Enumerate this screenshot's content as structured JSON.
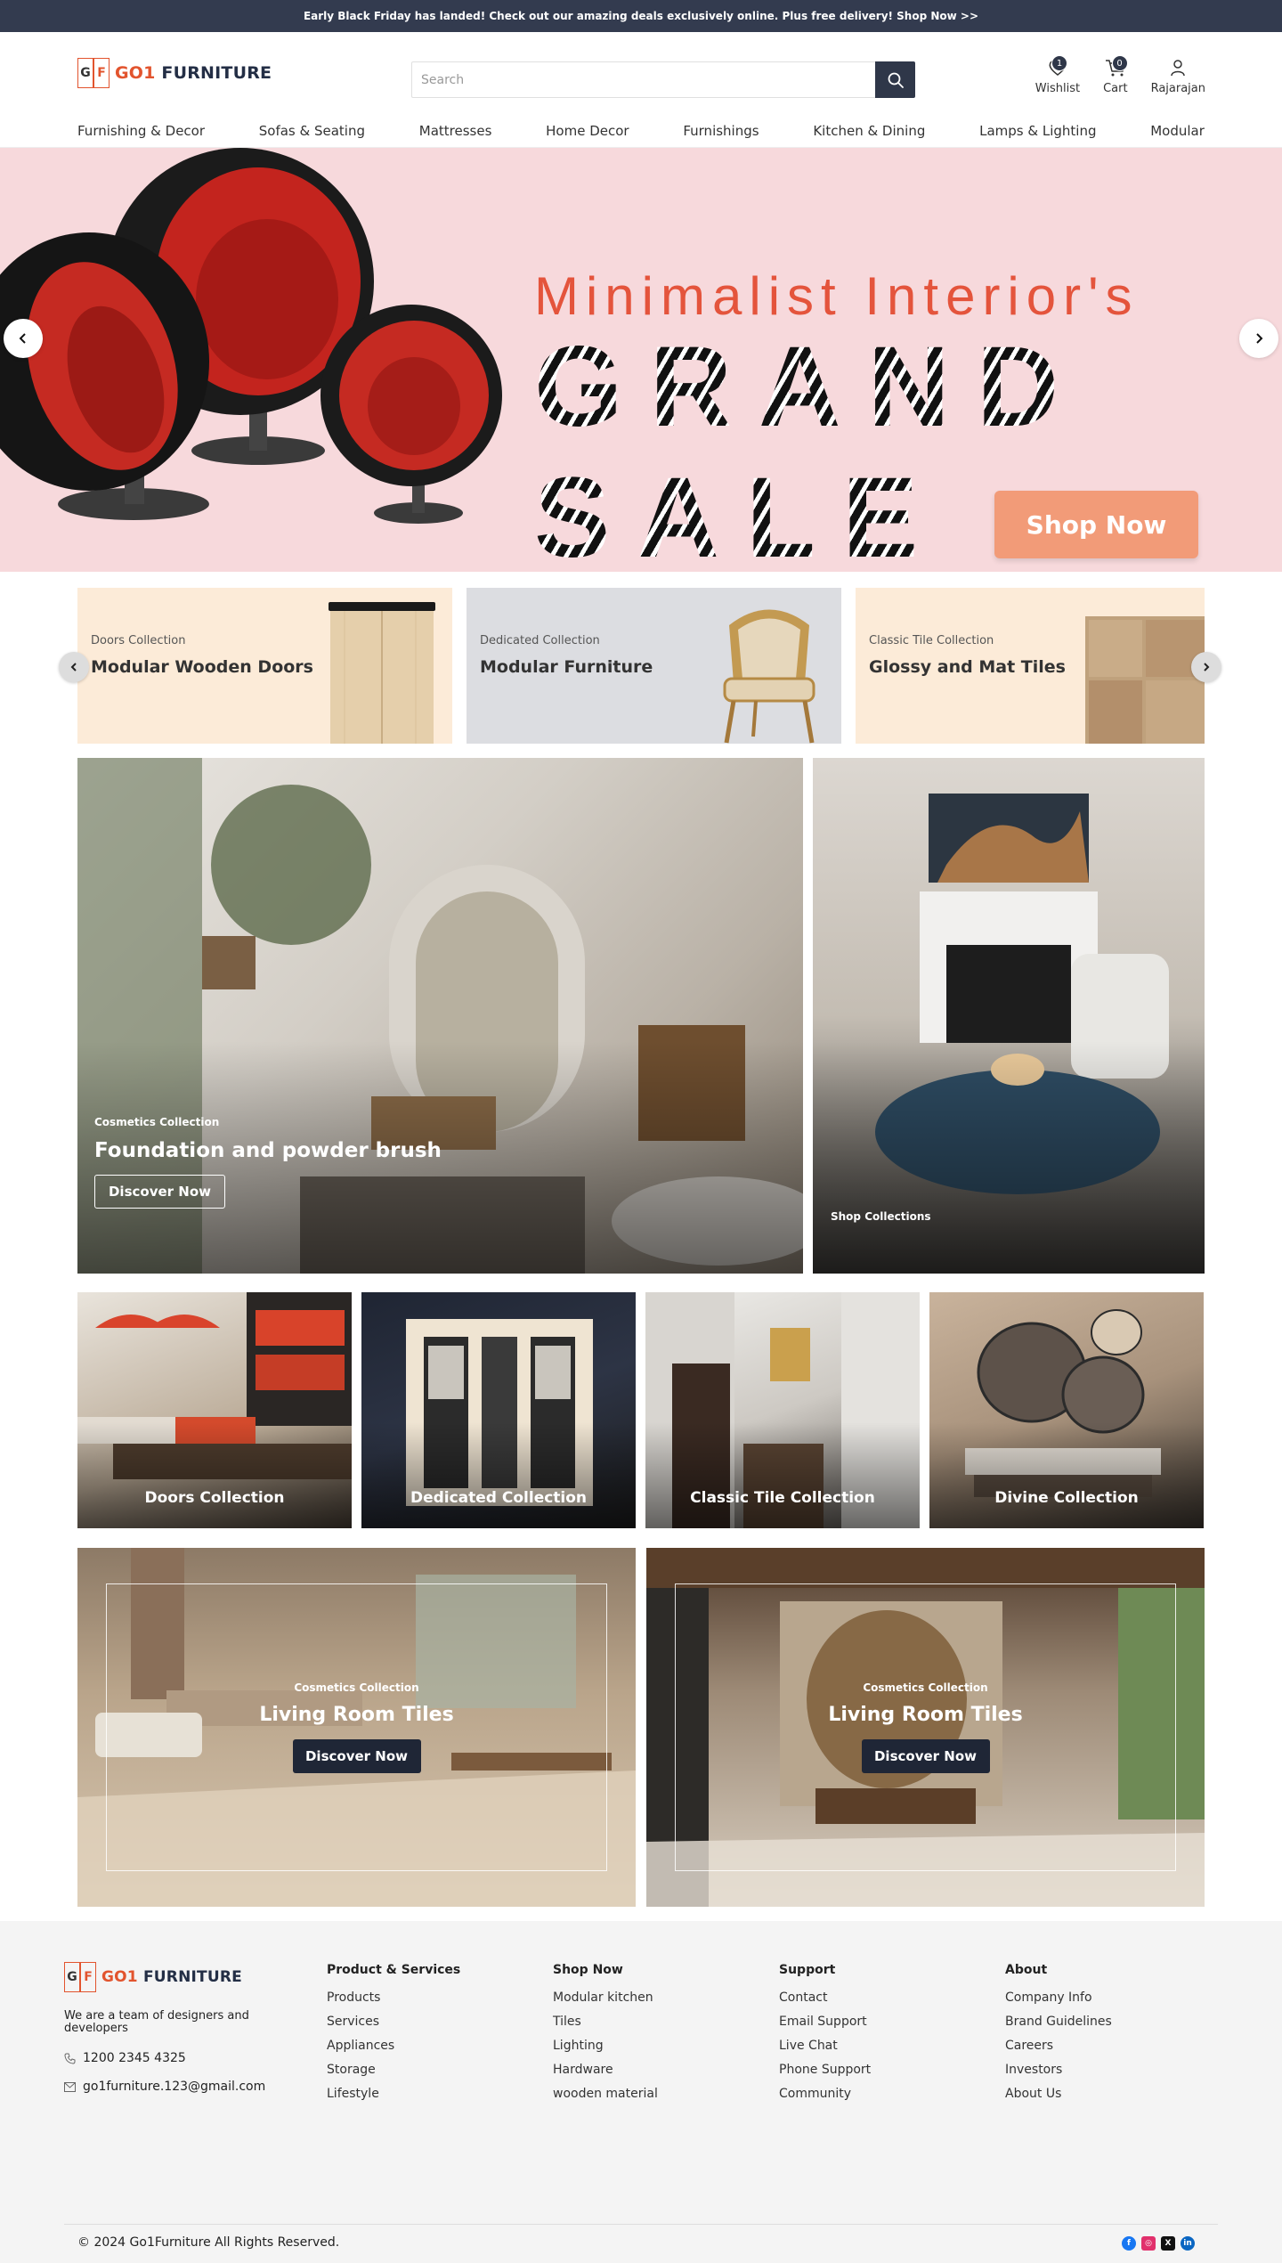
{
  "announcement": "Early Black Friday has landed! Check out our amazing deals exclusively online. Plus free delivery! Shop Now >>",
  "brand": {
    "mark_left": "G",
    "mark_right": "F",
    "name_accent": "GO1",
    "name_rest": "FURNITURE"
  },
  "search": {
    "placeholder": "Search"
  },
  "header_actions": [
    {
      "label": "Wishlist",
      "count": "1"
    },
    {
      "label": "Cart",
      "count": "0"
    },
    {
      "label": "Rajarajan"
    }
  ],
  "nav": [
    "Furnishing & Decor",
    "Sofas & Seating",
    "Mattresses",
    "Home Decor",
    "Furnishings",
    "Kitchen & Dining",
    "Lamps & Lighting",
    "Modular"
  ],
  "hero": {
    "subtitle": "Minimalist Interior's",
    "title": "GRAND SALE",
    "cta": "Shop Now"
  },
  "collections": [
    {
      "kicker": "Doors Collection",
      "title": "Modular Wooden Doors"
    },
    {
      "kicker": "Dedicated Collection",
      "title": "Modular Furniture"
    },
    {
      "kicker": "Classic Tile Collection",
      "title": "Glossy and Mat Tiles"
    }
  ],
  "feature_main": {
    "kicker": "Cosmetics Collection",
    "title": "Foundation and powder brush",
    "cta": "Discover Now"
  },
  "feature_side": {
    "label": "Shop Collections"
  },
  "tiles": [
    "Doors Collection",
    "Dedicated Collection",
    "Classic Tile Collection",
    "Divine Collection"
  ],
  "tile_cards": [
    {
      "kicker": "Cosmetics Collection",
      "title": "Living Room Tiles",
      "cta": "Discover Now"
    },
    {
      "kicker": "Cosmetics Collection",
      "title": "Living Room Tiles",
      "cta": "Discover Now"
    }
  ],
  "footer": {
    "about": "We are a team of designers and developers",
    "phone": "1200 2345 4325",
    "email": "go1furniture.123@gmail.com",
    "columns": [
      {
        "heading": "Product & Services",
        "links": [
          "Products",
          "Services",
          "Appliances",
          "Storage",
          "Lifestyle"
        ]
      },
      {
        "heading": "Shop Now",
        "links": [
          "Modular kitchen",
          "Tiles",
          "Lighting",
          "Hardware",
          "wooden material"
        ]
      },
      {
        "heading": "Support",
        "links": [
          "Contact",
          "Email Support",
          "Live Chat",
          "Phone Support",
          "Community"
        ]
      },
      {
        "heading": "About",
        "links": [
          "Company Info",
          "Brand Guidelines",
          "Careers",
          "Investors",
          "About Us"
        ]
      }
    ],
    "copyright": "© 2024 Go1Furniture All Rights Reserved."
  },
  "colors": {
    "accent": "#e2542e",
    "navy": "#2f3749",
    "hero_bg": "#f7d9dc",
    "cta": "#f29b78"
  }
}
